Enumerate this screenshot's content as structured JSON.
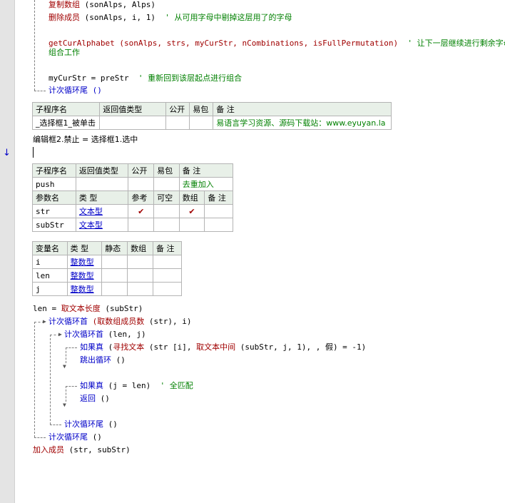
{
  "code_top": {
    "l1_cmd": "复制数组",
    "l1_args": " (sonAlps, Alps)",
    "l2_cmd": "删除成员",
    "l2_args": " (sonAlps, i, 1)",
    "l2_comment": "  ' 从可用字母中剔掉这层用了的字母",
    "l3_call": "getCurAlphabet (sonAlps, strs, myCurStr, nCombinations, isFullPermutation)",
    "l3_comment": "  ' 让下一层继续进行剩余字母的",
    "l3_comment_wrap": "组合工作",
    "l4_assign": "myCurStr = preStr",
    "l4_comment": "  ' 重新回到该层起点进行组合",
    "l5_loop_end": "计次循环尾 ()"
  },
  "sub_table1": {
    "headers": [
      "子程序名",
      "返回值类型",
      "公开",
      "易包",
      "备 注"
    ],
    "row": [
      "_选择框1_被单击",
      "",
      "",
      "",
      "易语言学习资源、源码下载站：www.eyuyan.la"
    ]
  },
  "line_edit": "编辑框2.禁止 = 选择框1.选中",
  "sub_table2": {
    "headers": [
      "子程序名",
      "返回值类型",
      "公开",
      "易包",
      "备 注"
    ],
    "row": [
      "push",
      "",
      "",
      "",
      "去重加入"
    ],
    "param_headers": [
      "参数名",
      "类 型",
      "参考",
      "可空",
      "数组",
      "备 注"
    ],
    "params": [
      {
        "name": "str",
        "type": "文本型",
        "ref": "✔",
        "nullable": "",
        "array": "✔",
        "note": ""
      },
      {
        "name": "subStr",
        "type": "文本型",
        "ref": "",
        "nullable": "",
        "array": "",
        "note": ""
      }
    ]
  },
  "var_table": {
    "headers": [
      "变量名",
      "类 型",
      "静态",
      "数组",
      "备 注"
    ],
    "vars": [
      {
        "name": "i",
        "type": "整数型"
      },
      {
        "name": "len",
        "type": "整数型"
      },
      {
        "name": "j",
        "type": "整数型"
      }
    ]
  },
  "code_bottom": {
    "b1_left": "len = ",
    "b1_cmd": "取文本长度",
    "b1_args": " (subStr)",
    "b2_kw": "计次循环首",
    "b2_cmd": " (取数组成员数",
    "b2_args": " (str), i)",
    "b3_kw": "计次循环首",
    "b3_args": " (len, j)",
    "b4_kw": "如果真",
    "b4_a": " (",
    "b4_cmd1": "寻找文本",
    "b4_b": " (str [i], ",
    "b4_cmd2": "取文本中间",
    "b4_c": " (subStr, j, 1), , 假) = -1)",
    "b5_kw": "跳出循环",
    "b5_args": " ()",
    "b6_kw": "如果真",
    "b6_args": " (j = len)",
    "b6_comment": "  ' 全匹配",
    "b7_kw": "返回",
    "b7_args": " ()",
    "b8_kw": "计次循环尾",
    "b8_args": " ()",
    "b9_kw": "计次循环尾",
    "b9_args": " ()",
    "b10_cmd": "加入成员",
    "b10_args": " (str, subStr)"
  }
}
